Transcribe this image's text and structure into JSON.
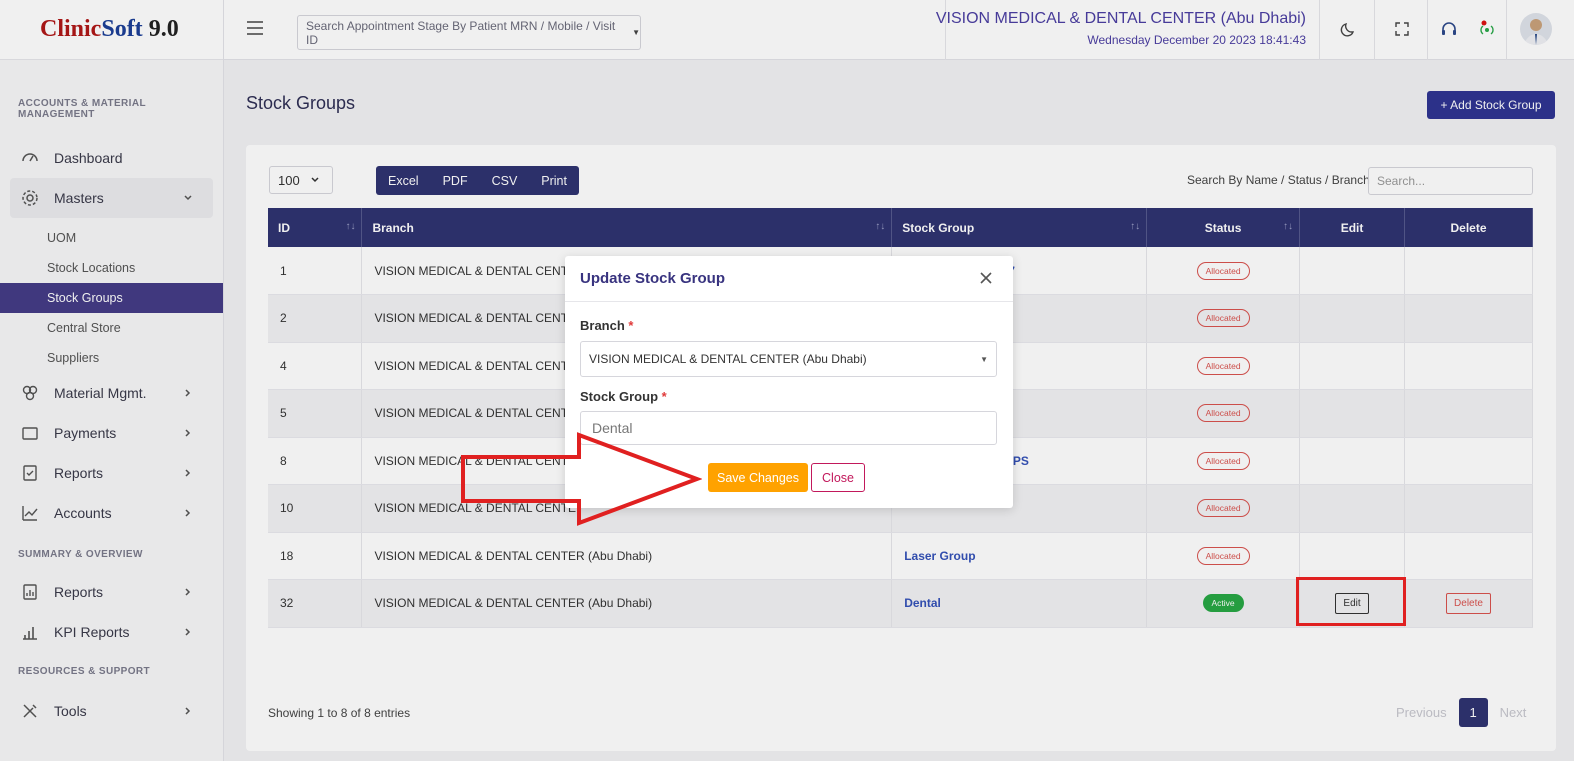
{
  "brand": {
    "part1": "Clinic",
    "part2": "Soft",
    "version": "9.0"
  },
  "sidebar": {
    "section1": "ACCOUNTS & MATERIAL MANAGEMENT",
    "dashboard": "Dashboard",
    "masters": "Masters",
    "sub": [
      "UOM",
      "Stock Locations",
      "Stock Groups",
      "Central Store",
      "Suppliers"
    ],
    "material": "Material Mgmt.",
    "payments": "Payments",
    "reports": "Reports",
    "accounts": "Accounts",
    "section2": "SUMMARY & OVERVIEW",
    "reports2": "Reports",
    "kpi": "KPI Reports",
    "section3": "RESOURCES & SUPPORT",
    "tools": "Tools"
  },
  "topbar": {
    "search_placeholder": "Search Appointment Stage By Patient MRN / Mobile / Visit ID",
    "clinic": "VISION MEDICAL & DENTAL CENTER (Abu Dhabi)",
    "datetime": "Wednesday December 20 2023 18:41:43"
  },
  "page": {
    "title": "Stock Groups",
    "add_button": "+ Add Stock Group",
    "page_length": "100",
    "export": [
      "Excel",
      "PDF",
      "CSV",
      "Print"
    ],
    "search_label": "Search By Name / Status / Branch",
    "search_placeholder": "Search...",
    "columns": [
      "ID",
      "Branch",
      "Stock Group",
      "Status",
      "Edit",
      "Delete"
    ],
    "rows": [
      {
        "id": "1",
        "branch": "VISION MEDICAL & DENTAL CENTE",
        "group": "7",
        "status": "Allocated"
      },
      {
        "id": "2",
        "branch": "VISION MEDICAL & DENTAL CENTE",
        "group": "",
        "status": "Allocated"
      },
      {
        "id": "4",
        "branch": "VISION MEDICAL & DENTAL CENTE",
        "group": "",
        "status": "Allocated"
      },
      {
        "id": "5",
        "branch": "VISION MEDICAL & DENTAL CENTE",
        "group": "",
        "status": "Allocated"
      },
      {
        "id": "8",
        "branch": "VISION MEDICAL & DENTAL CENTE",
        "group": "UPS",
        "status": "Allocated"
      },
      {
        "id": "10",
        "branch": "VISION MEDICAL & DENTAL CENTE",
        "group": "",
        "status": "Allocated"
      },
      {
        "id": "18",
        "branch": "VISION MEDICAL & DENTAL CENTER (Abu Dhabi)",
        "group": "Laser Group",
        "status": "Allocated"
      },
      {
        "id": "32",
        "branch": "VISION MEDICAL & DENTAL CENTER (Abu Dhabi)",
        "group": "Dental",
        "status": "Active",
        "edit": "Edit",
        "delete": "Delete"
      }
    ],
    "entries": "Showing 1 to 8 of 8 entries",
    "pager": {
      "prev": "Previous",
      "current": "1",
      "next": "Next"
    }
  },
  "modal": {
    "title": "Update Stock Group",
    "branch_label": "Branch",
    "branch_value": "VISION MEDICAL & DENTAL CENTER (Abu Dhabi)",
    "group_label": "Stock Group",
    "group_value": "Dental",
    "required_mark": "*",
    "save": "Save Changes",
    "close": "Close"
  },
  "colors": {
    "accent": "#2f3371",
    "active_nav": "#443c86",
    "save": "#ffa200",
    "annotation": "#e02020"
  }
}
